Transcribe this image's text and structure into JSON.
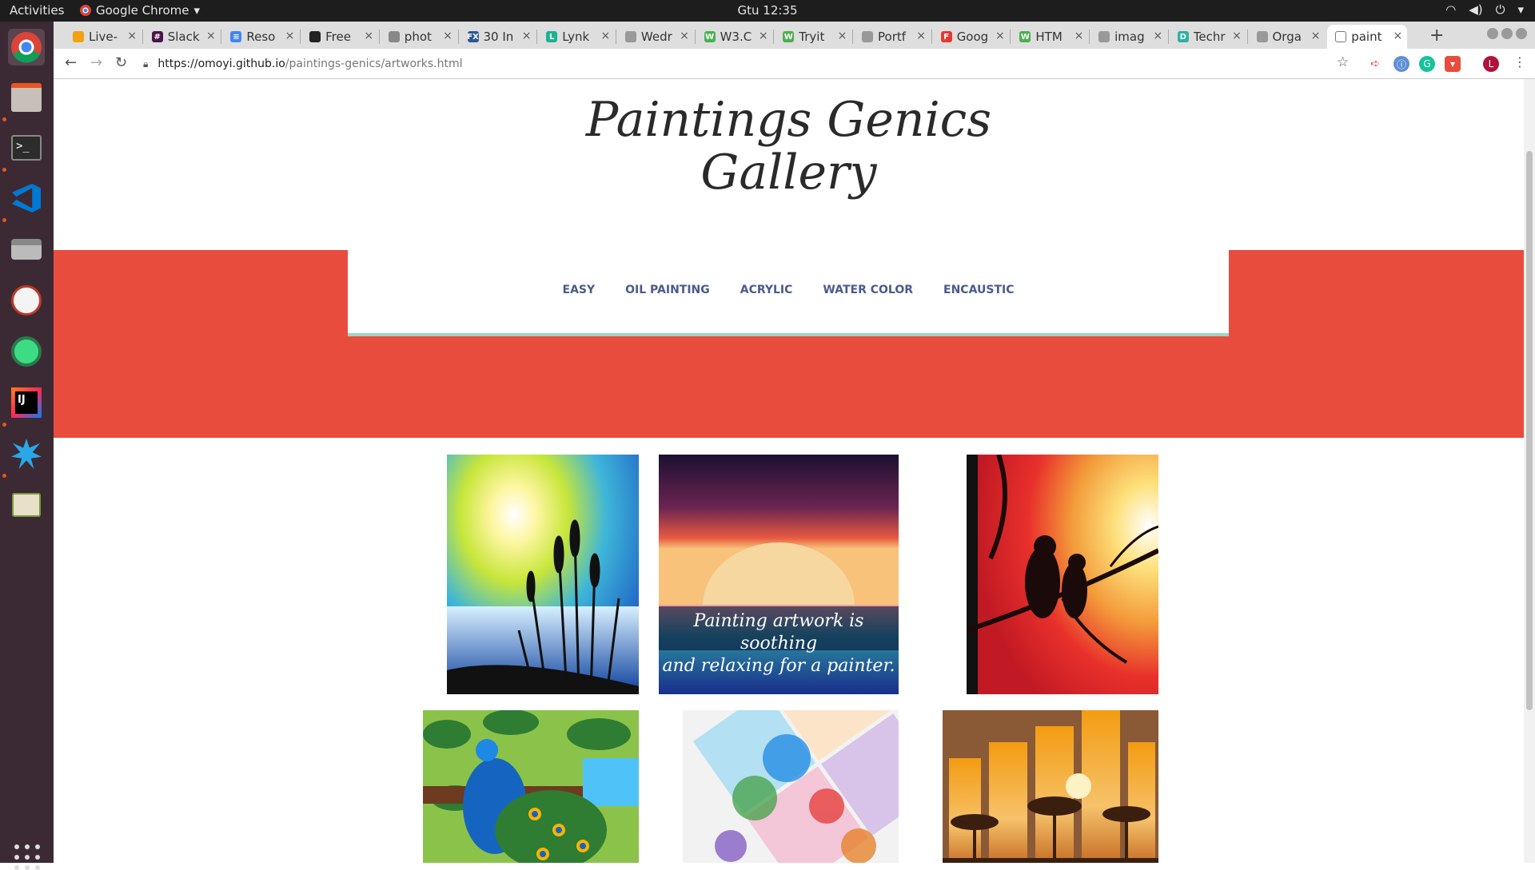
{
  "system": {
    "activities": "Activities",
    "app_name": "Google Chrome",
    "clock": "Gtu 12:35"
  },
  "browser": {
    "tabs": [
      {
        "title": "Live-",
        "color": "#f2a20c",
        "glyph": ""
      },
      {
        "title": "Slack",
        "color": "#4a154b",
        "glyph": "#"
      },
      {
        "title": "Reso",
        "color": "#4285f4",
        "glyph": "≡"
      },
      {
        "title": "Free",
        "color": "#222222",
        "glyph": ""
      },
      {
        "title": "phot",
        "color": "#888888",
        "glyph": ""
      },
      {
        "title": "30 In",
        "color": "#2b5797",
        "glyph": "FX"
      },
      {
        "title": "Lynk",
        "color": "#1ab394",
        "glyph": "L"
      },
      {
        "title": "Wedr",
        "color": "#999999",
        "glyph": ""
      },
      {
        "title": "W3.C",
        "color": "#4caf50",
        "glyph": "W"
      },
      {
        "title": "Tryit",
        "color": "#4caf50",
        "glyph": "W"
      },
      {
        "title": "Portf",
        "color": "#999999",
        "glyph": ""
      },
      {
        "title": "Goog",
        "color": "#e53935",
        "glyph": "F"
      },
      {
        "title": "HTM",
        "color": "#4caf50",
        "glyph": "W"
      },
      {
        "title": "imag",
        "color": "#999999",
        "glyph": ""
      },
      {
        "title": "Techr",
        "color": "#2bb3a0",
        "glyph": "D"
      },
      {
        "title": "Orga",
        "color": "#999999",
        "glyph": ""
      },
      {
        "title": "paint",
        "color": "#ffffff",
        "glyph": ""
      }
    ],
    "url_host": "https://omoyi.github.io",
    "url_path": "/paintings-genics/artworks.html"
  },
  "page": {
    "title_line1": "Paintings Genics",
    "title_line2": "Gallery",
    "nav": [
      "EASY",
      "OIL PAINTING",
      "ACRYLIC",
      "WATER COLOR",
      "ENCAUSTIC"
    ],
    "artwork_caption_line1": "Painting artwork is soothing",
    "artwork_caption_line2": "and relaxing for a painter."
  },
  "colors": {
    "hero": "#e74c3c",
    "nav_text": "#4a5a8c",
    "nav_underline": "#9fd3c7"
  }
}
